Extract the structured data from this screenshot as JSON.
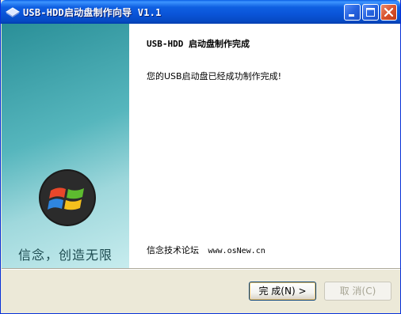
{
  "window": {
    "title": "USB-HDD启动盘制作向导 V1.1",
    "icon": "usb-disk-icon",
    "controls": [
      "minimize-icon",
      "maximize-icon",
      "close-icon"
    ]
  },
  "sidebar": {
    "logo": "windows-logo-icon",
    "slogan": "信念，创造无限"
  },
  "content": {
    "heading": "USB-HDD 启动盘制作完成",
    "message": "您的USB启动盘已经成功制作完成!",
    "forum_label": "信念技术论坛",
    "forum_url": "www.osNew.cn"
  },
  "buttons": {
    "finish": "完 成(N) >",
    "cancel": "取 消(C)"
  },
  "colors": {
    "titlebar": "#0a54d8",
    "sidebar": "#56b6bd",
    "dialog_bg": "#ece9d8"
  }
}
